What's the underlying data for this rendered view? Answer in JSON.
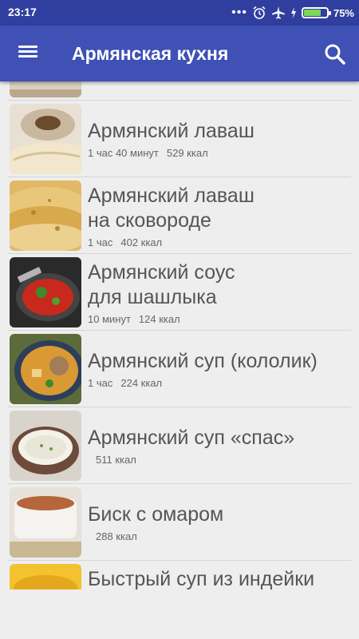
{
  "status_bar": {
    "time": "23:17",
    "battery_percent": "75%",
    "battery_level": 0.75,
    "icons": [
      "more-dots-icon",
      "alarm-icon",
      "airplane-icon",
      "charging-icon",
      "battery-icon"
    ]
  },
  "app_bar": {
    "title": "Армянская кухня",
    "icons": [
      "menu-icon",
      "search-icon"
    ],
    "color": "#3f51b5"
  },
  "recipes": [
    {
      "title": "Армянский лаваш",
      "time": "1 час 40 минут",
      "kcal": "529 ккал"
    },
    {
      "title": "Армянский лаваш на сковороде",
      "time": "1 час",
      "kcal": "402 ккал"
    },
    {
      "title": "Армянский соус для шашлыка",
      "time": "10 минут",
      "kcal": "124 ккал"
    },
    {
      "title": "Армянский суп (кололик)",
      "time": "1 час",
      "kcal": "224 ккал"
    },
    {
      "title": "Армянский суп «спас»",
      "time": "",
      "kcal": "511 ккал"
    },
    {
      "title": "Биск с омаром",
      "time": "",
      "kcal": "288 ккал"
    },
    {
      "title": "Быстрый суп из индейки",
      "time": "",
      "kcal": ""
    }
  ]
}
